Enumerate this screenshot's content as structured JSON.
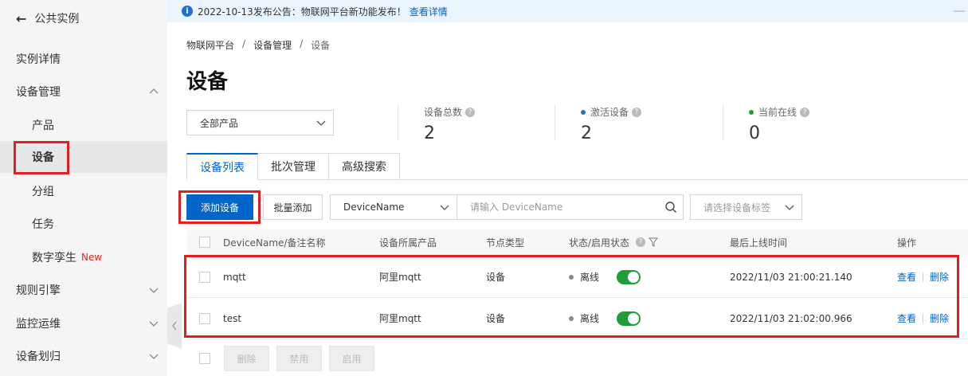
{
  "sidebar": {
    "back_label": "公共实例",
    "items": [
      {
        "label": "实例详情"
      },
      {
        "label": "设备管理"
      },
      {
        "label": "产品"
      },
      {
        "label": "设备"
      },
      {
        "label": "分组"
      },
      {
        "label": "任务"
      },
      {
        "label": "数字孪生",
        "badge": "New"
      },
      {
        "label": "规则引擎"
      },
      {
        "label": "监控运维"
      },
      {
        "label": "设备划归"
      }
    ]
  },
  "notice": {
    "text": "2022-10-13发布公告：物联网平台新功能发布！",
    "link": "查看详情"
  },
  "breadcrumb": [
    "物联网平台",
    "设备管理",
    "设备"
  ],
  "page_title": "设备",
  "product_filter": {
    "value": "全部产品"
  },
  "stats": [
    {
      "label": "设备总数",
      "value": "2"
    },
    {
      "label": "激活设备",
      "value": "2",
      "dot_color": "#1f6fd6"
    },
    {
      "label": "当前在线",
      "value": "0",
      "dot_color": "#1f9d3a"
    }
  ],
  "tabs": [
    "设备列表",
    "批次管理",
    "高级搜索"
  ],
  "toolbar": {
    "add_label": "添加设备",
    "batch_label": "批量添加",
    "search_type": "DeviceName",
    "search_placeholder": "请输入 DeviceName",
    "tag_placeholder": "请选择设备标签"
  },
  "table": {
    "headers": [
      "DeviceName/备注名称",
      "设备所属产品",
      "节点类型",
      "状态/启用状态",
      "最后上线时间",
      "操作"
    ],
    "rows": [
      {
        "name": "mqtt",
        "product": "阿里mqtt",
        "node": "设备",
        "status": "离线",
        "enabled": true,
        "last_online": "2022/11/03 21:00:21.140",
        "op_view": "查看",
        "op_delete": "删除"
      },
      {
        "name": "test",
        "product": "阿里mqtt",
        "node": "设备",
        "status": "离线",
        "enabled": true,
        "last_online": "2022/11/03 21:02:00.966",
        "op_view": "查看",
        "op_delete": "删除"
      }
    ]
  },
  "footer_actions": [
    "删除",
    "禁用",
    "启用"
  ],
  "colors": {
    "primary": "#0064c8",
    "highlight": "#e02020",
    "toggle_on": "#1f9d3a"
  }
}
